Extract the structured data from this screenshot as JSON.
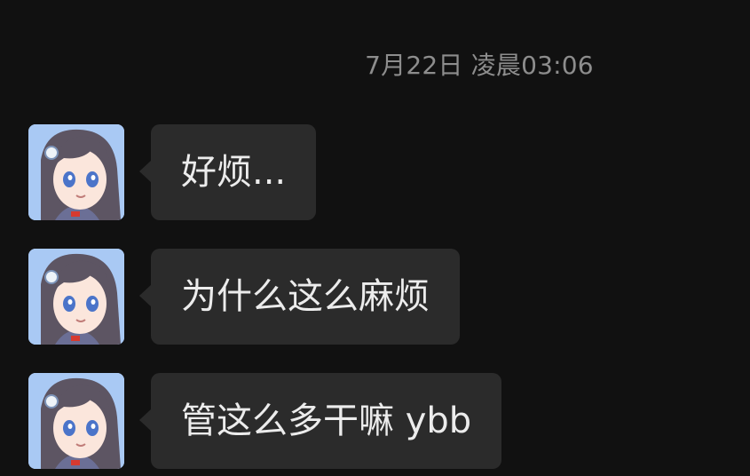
{
  "chat": {
    "timestamp": "7月22日 凌晨03:06",
    "messages": [
      {
        "text": "好烦..."
      },
      {
        "text": "为什么这么麻烦"
      },
      {
        "text": "管这么多干嘛 ybb"
      }
    ]
  },
  "colors": {
    "background": "#111111",
    "bubble": "#2b2b2b",
    "text": "#ececec",
    "timestamp": "#8d8d8d"
  }
}
